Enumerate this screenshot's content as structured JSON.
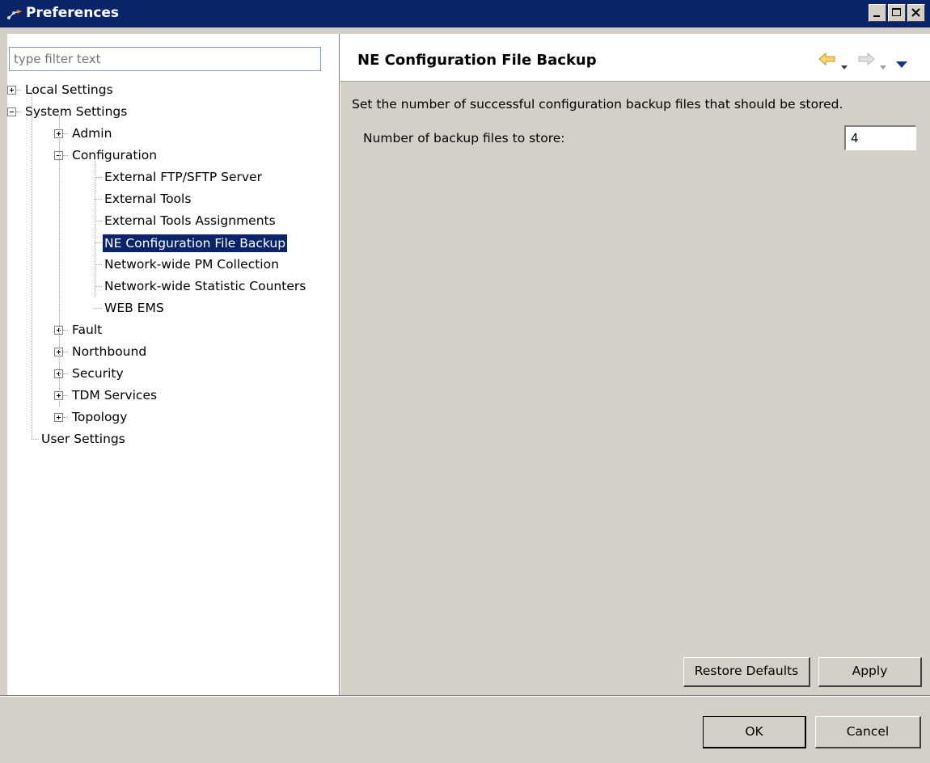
{
  "window": {
    "title": "Preferences",
    "title_icon": "eclipse-preferences-icon",
    "caption_buttons": [
      "minimize-icon",
      "maximize-icon",
      "close-icon"
    ]
  },
  "filter": {
    "placeholder": "type filter text",
    "value": ""
  },
  "tree": {
    "items": [
      {
        "label": "Local Settings",
        "level": 0,
        "expander": "plus"
      },
      {
        "label": "System Settings",
        "level": 0,
        "expander": "minus"
      },
      {
        "label": "Admin",
        "level": 1,
        "expander": "plus"
      },
      {
        "label": "Configuration",
        "level": 1,
        "expander": "minus"
      },
      {
        "label": "External FTP/SFTP Server",
        "level": 2,
        "expander": "none"
      },
      {
        "label": "External Tools",
        "level": 2,
        "expander": "none"
      },
      {
        "label": "External Tools Assignments",
        "level": 2,
        "expander": "none"
      },
      {
        "label": "NE Configuration File Backup",
        "level": 2,
        "expander": "none",
        "selected": true
      },
      {
        "label": "Network-wide PM Collection",
        "level": 2,
        "expander": "none"
      },
      {
        "label": "Network-wide Statistic Counters",
        "level": 2,
        "expander": "none"
      },
      {
        "label": "WEB EMS",
        "level": 2,
        "expander": "none"
      },
      {
        "label": "Fault",
        "level": 1,
        "expander": "plus"
      },
      {
        "label": "Northbound",
        "level": 1,
        "expander": "plus"
      },
      {
        "label": "Security",
        "level": 1,
        "expander": "plus"
      },
      {
        "label": "TDM Services",
        "level": 1,
        "expander": "plus"
      },
      {
        "label": "Topology",
        "level": 1,
        "expander": "plus"
      },
      {
        "label": "User Settings",
        "level": 0,
        "expander": "none"
      }
    ]
  },
  "page": {
    "title": "NE Configuration File Backup",
    "nav_icons": [
      "back-arrow-icon",
      "back-dropdown-icon",
      "forward-arrow-icon",
      "forward-dropdown-icon",
      "view-menu-icon"
    ],
    "description": "Set the number of successful configuration backup files that should be stored.",
    "field_label": "Number of backup files to store:",
    "field_value": "4",
    "restore_defaults_label": "Restore Defaults",
    "apply_label": "Apply"
  },
  "dialog": {
    "ok_label": "OK",
    "cancel_label": "Cancel"
  },
  "colors": {
    "titlebar": "#0a246a",
    "selection": "#0a246a",
    "face": "#d4d0c8",
    "back_arrow": "#f0c030"
  }
}
